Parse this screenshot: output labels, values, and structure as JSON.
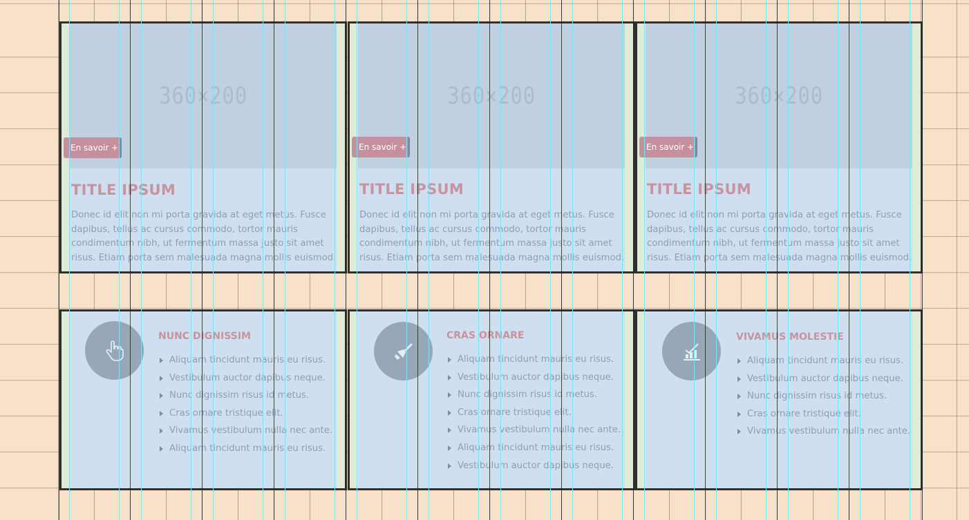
{
  "cards": [
    {
      "image_text": "360×200",
      "button_label": "En savoir +",
      "title": "TITLE IPSUM",
      "text": "Donec id elit non mi porta gravida at eget metus. Fusce dapibus, tellus ac cursus commodo, tortor mauris condimentum nibh, ut fermentum massa justo sit amet risus. Etiam porta sem malesuada magna mollis euismod."
    },
    {
      "image_text": "360×200",
      "button_label": "En savoir +",
      "title": "TITLE IPSUM",
      "text": "Donec id elit non mi porta gravida at eget metus. Fusce dapibus, tellus ac cursus commodo, tortor mauris condimentum nibh, ut fermentum massa justo sit amet risus. Etiam porta sem malesuada magna mollis euismod."
    },
    {
      "image_text": "360×200",
      "button_label": "En savoir +",
      "title": "TITLE IPSUM",
      "text": "Donec id elit non mi porta gravida at eget metus. Fusce dapibus, tellus ac cursus commodo, tortor mauris condimentum nibh, ut fermentum massa justo sit amet risus. Etiam porta sem malesuada magna mollis euismod."
    }
  ],
  "features": [
    {
      "icon": "hand-pointer-icon",
      "title": "NUNC DIGNISSIM",
      "items": [
        "Aliquam tincidunt mauris eu risus.",
        "Vestibulum auctor dapibus neque.",
        "Nunc dignissim risus id metus.",
        "Cras ornare tristique elit.",
        "Vivamus vestibulum nulla nec ante.",
        "Aliquam tincidunt mauris eu risus."
      ]
    },
    {
      "icon": "paint-brush-icon",
      "title": "CRAS ORNARE",
      "items": [
        "Aliquam tincidunt mauris eu risus.",
        "Vestibulum auctor dapibus neque.",
        "Nunc dignissim risus id metus.",
        "Cras ornare tristique elit.",
        "Vivamus vestibulum nulla nec ante.",
        "Aliquam tincidunt mauris eu risus.",
        "Vestibulum auctor dapibus neque."
      ]
    },
    {
      "icon": "bar-chart-check-icon",
      "title": "VIVAMUS MOLESTIE",
      "items": [
        "Aliquam tincidunt mauris eu risus.",
        "Vestibulum auctor dapibus neque.",
        "Nunc dignissim risus id metus.",
        "Cras ornare tristique elit.",
        "Vivamus vestibulum nulla nec ante."
      ]
    }
  ],
  "colors": {
    "background": "#f8e1c9",
    "card": "#cfdff0",
    "accent": "#c6949f",
    "muted_text": "#8a9fb7",
    "icon_circle": "#97a7b8"
  }
}
